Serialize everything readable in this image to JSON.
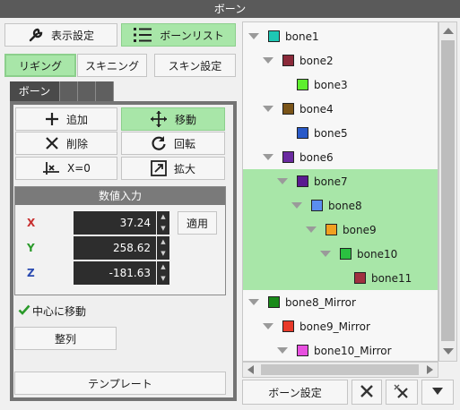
{
  "window": {
    "title": "ボーン"
  },
  "top_buttons": {
    "display_settings": "表示設定",
    "bone_list": "ボーンリスト"
  },
  "mode_buttons": {
    "rigging": "リギング",
    "skinning": "スキニング",
    "skin_settings": "スキン設定"
  },
  "tabs": {
    "bone": "ボーン"
  },
  "tools": {
    "add": "追加",
    "move": "移動",
    "delete": "削除",
    "rotate": "回転",
    "x_zero": "X=0",
    "scale": "拡大"
  },
  "numeric_input": {
    "header": "数値入力",
    "x_label": "X",
    "y_label": "Y",
    "z_label": "Z",
    "x_value": "37.24",
    "y_value": "258.62",
    "z_value": "-181.63",
    "apply": "適用"
  },
  "options": {
    "move_to_center": "中心に移動",
    "move_to_center_checked": true,
    "align": "整列",
    "template": "テンプレート"
  },
  "bone_tree": [
    {
      "name": "bone1",
      "color": "#1ec8b4",
      "indent": 0,
      "expanded": true,
      "highlight": false
    },
    {
      "name": "bone2",
      "color": "#8b2a3a",
      "indent": 1,
      "expanded": true,
      "highlight": false
    },
    {
      "name": "bone3",
      "color": "#5eef2e",
      "indent": 2,
      "expanded": false,
      "highlight": false
    },
    {
      "name": "bone4",
      "color": "#7a5418",
      "indent": 1,
      "expanded": true,
      "highlight": false
    },
    {
      "name": "bone5",
      "color": "#2a5ac8",
      "indent": 2,
      "expanded": false,
      "highlight": false
    },
    {
      "name": "bone6",
      "color": "#6a2aa0",
      "indent": 1,
      "expanded": true,
      "highlight": false
    },
    {
      "name": "bone7",
      "color": "#5a1a90",
      "indent": 2,
      "expanded": true,
      "highlight": true
    },
    {
      "name": "bone8",
      "color": "#5a8ef0",
      "indent": 3,
      "expanded": true,
      "highlight": true
    },
    {
      "name": "bone9",
      "color": "#f0a020",
      "indent": 4,
      "expanded": true,
      "highlight": true
    },
    {
      "name": "bone10",
      "color": "#2ac040",
      "indent": 5,
      "expanded": true,
      "highlight": true
    },
    {
      "name": "bone11",
      "color": "#a03040",
      "indent": 6,
      "expanded": false,
      "highlight": true
    },
    {
      "name": "bone8_Mirror",
      "color": "#1a8a1a",
      "indent": 0,
      "expanded": true,
      "highlight": false
    },
    {
      "name": "bone9_Mirror",
      "color": "#e83a2a",
      "indent": 1,
      "expanded": true,
      "highlight": false
    },
    {
      "name": "bone10_Mirror",
      "color": "#e850e0",
      "indent": 2,
      "expanded": true,
      "highlight": false
    }
  ],
  "bottom_bar": {
    "bone_settings": "ボーン設定"
  },
  "icons": {
    "wrench": "wrench-icon",
    "list": "list-icon",
    "plus": "plus-icon",
    "move": "move-arrows-icon",
    "delete": "x-icon",
    "rotate": "rotate-icon",
    "x_zero": "x-zero-icon",
    "scale": "scale-icon",
    "check": "checkmark-icon",
    "close": "close-icon",
    "close_all": "close-all-icon",
    "dropdown": "triangle-down-icon"
  }
}
